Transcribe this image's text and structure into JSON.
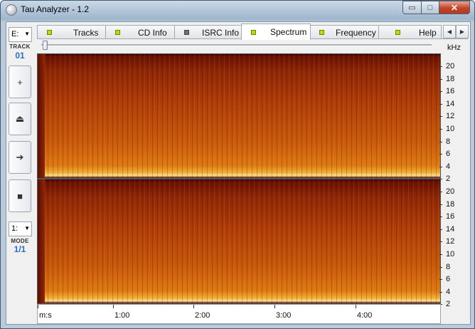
{
  "window": {
    "title": "Tau Analyzer - 1.2",
    "min_label": "▭",
    "max_label": "□",
    "close_label": "✕"
  },
  "leftbar": {
    "drive_combo": "E:",
    "track_tag": "TRACK",
    "track_value": "01",
    "buttons": {
      "add": "+",
      "eject": "⏏",
      "play": "➔",
      "stop": "■"
    },
    "mode_combo": "1:",
    "mode_tag": "MODE",
    "mode_value": "1/1"
  },
  "tabs": [
    {
      "label": "Tracks",
      "led": "green",
      "active": false
    },
    {
      "label": "CD Info",
      "led": "green",
      "active": false
    },
    {
      "label": "ISRC Info",
      "led": "gray",
      "active": false
    },
    {
      "label": "Spectrum",
      "led": "green",
      "active": true
    },
    {
      "label": "Frequency",
      "led": "green",
      "active": false
    },
    {
      "label": "Help",
      "led": "green",
      "active": false
    }
  ],
  "tab_nav": {
    "prev": "◀",
    "next": "▶"
  },
  "spectrum": {
    "unit_label": "kHz",
    "freq_ticks": [
      "20",
      "18",
      "16",
      "14",
      "12",
      "10",
      "8",
      "6",
      "4",
      "2"
    ],
    "time_axis_label": "m:s",
    "time_ticks": [
      "1:00",
      "2:00",
      "3:00",
      "4:00"
    ]
  },
  "colors": {
    "spectrum_dark": "#3a0404",
    "spectrum_mid": "#b03e08",
    "spectrum_hot": "#ffe39a",
    "accent_blue": "#2a6fbf",
    "led_green": "#b7e000"
  }
}
